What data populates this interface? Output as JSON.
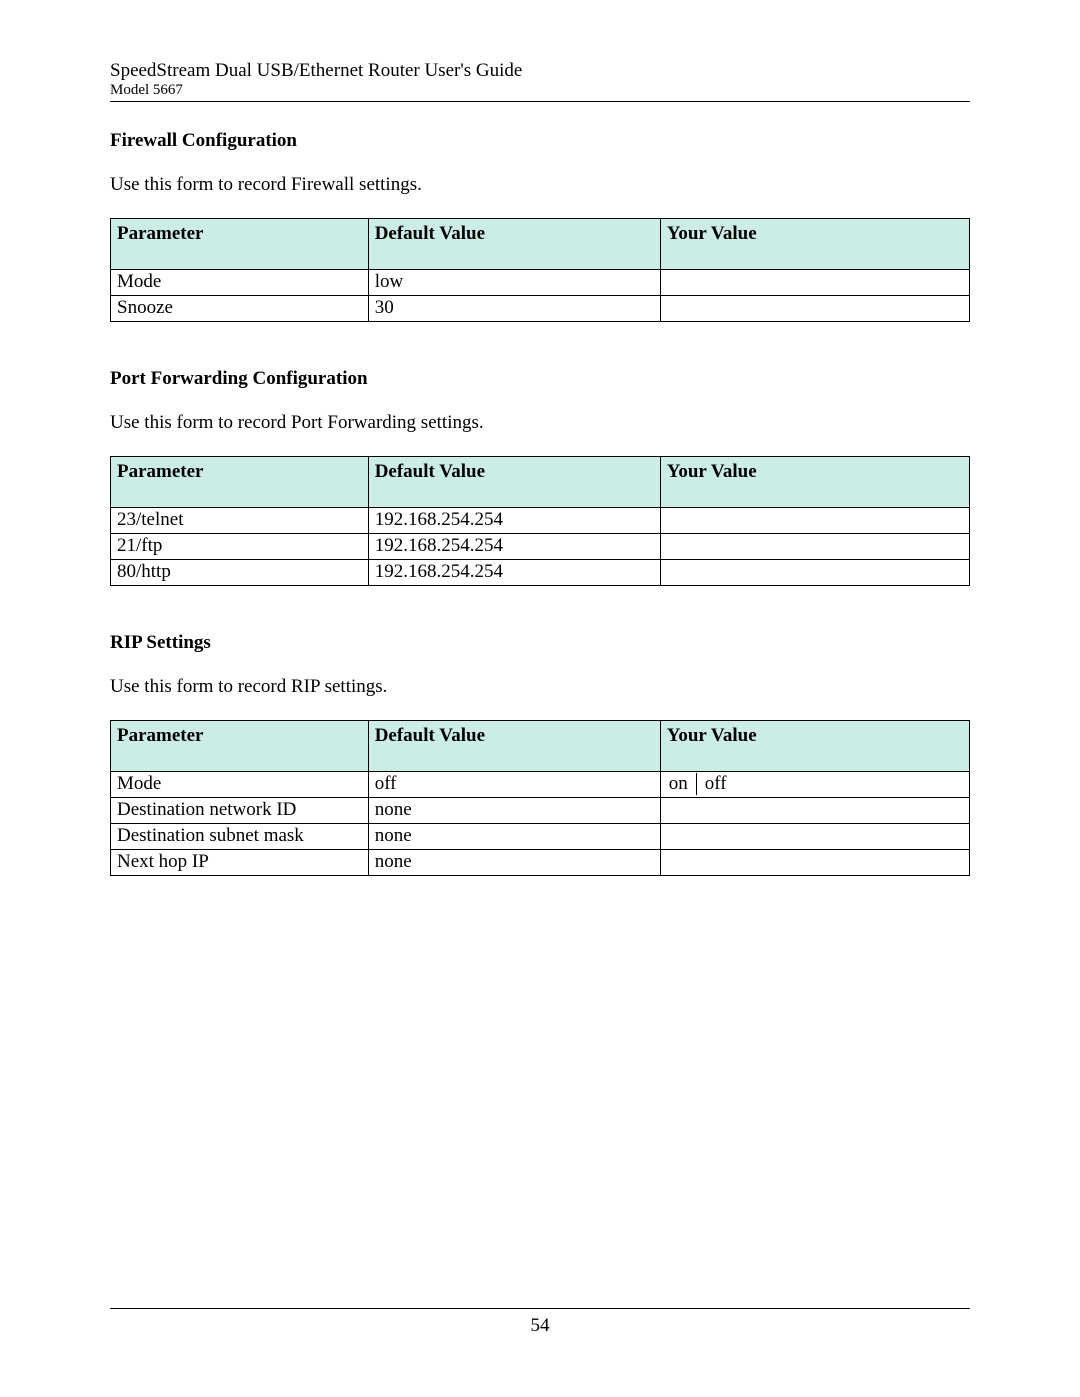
{
  "header": {
    "title": "SpeedStream Dual USB/Ethernet Router User's Guide",
    "model": "Model 5667"
  },
  "columns": {
    "parameter": "Parameter",
    "default_value": "Default Value",
    "your_value": "Your Value"
  },
  "sections": {
    "firewall": {
      "heading": "Firewall Configuration",
      "text": "Use this form to record Firewall settings.",
      "rows": [
        {
          "parameter": "Mode",
          "default_value": "low",
          "your_value": ""
        },
        {
          "parameter": "Snooze",
          "default_value": "30",
          "your_value": ""
        }
      ]
    },
    "portfwd": {
      "heading": "Port Forwarding Configuration",
      "text": "Use this form to record Port Forwarding settings.",
      "rows": [
        {
          "parameter": "23/telnet",
          "default_value": "192.168.254.254",
          "your_value": ""
        },
        {
          "parameter": "21/ftp",
          "default_value": "192.168.254.254",
          "your_value": ""
        },
        {
          "parameter": "80/http",
          "default_value": "192.168.254.254",
          "your_value": ""
        }
      ]
    },
    "rip": {
      "heading": "RIP Settings",
      "text": "Use this form to record RIP settings.",
      "rows": [
        {
          "parameter": "Mode",
          "default_value": "off",
          "your_value_options": [
            "on",
            "off"
          ]
        },
        {
          "parameter": "Destination network ID",
          "default_value": "none",
          "your_value": ""
        },
        {
          "parameter": "Destination subnet mask",
          "default_value": "none",
          "your_value": ""
        },
        {
          "parameter": "Next hop IP",
          "default_value": "none",
          "your_value": ""
        }
      ]
    }
  },
  "page_number": "54"
}
